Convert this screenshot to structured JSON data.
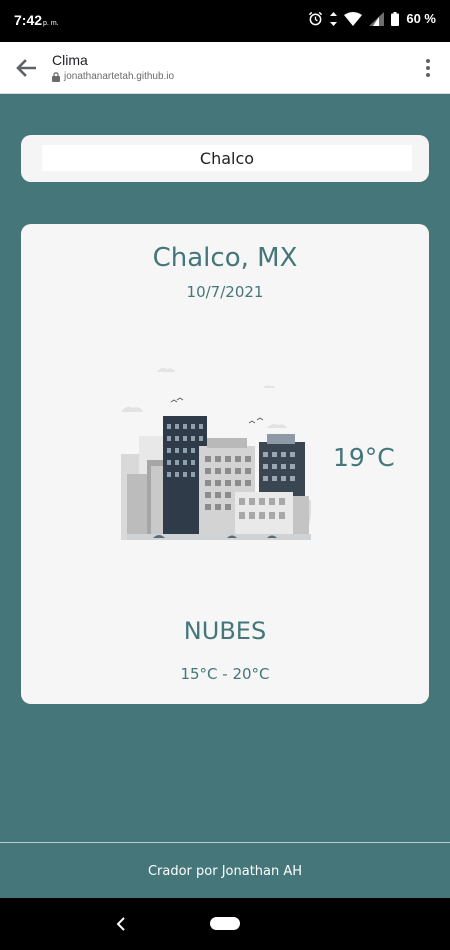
{
  "status_bar": {
    "time": "7:42",
    "time_suffix": "p. m.",
    "battery": "60 %",
    "icons": [
      "alarm-icon",
      "data-arrows-icon",
      "wifi-icon",
      "cell-signal-icon",
      "battery-icon"
    ]
  },
  "browser": {
    "title": "Clima",
    "url": "jonathanartetah.github.io",
    "icons": [
      "back-arrow-icon",
      "lock-icon",
      "more-vert-icon"
    ]
  },
  "search": {
    "value": "Chalco"
  },
  "weather": {
    "city": "Chalco, MX",
    "date": "10/7/2021",
    "temperature": "19°C",
    "condition": "NUBES",
    "range": "15°C - 20°C",
    "illustration": "city-buildings-clouds-illustration"
  },
  "footer": {
    "text": "Crador por Jonathan AH"
  },
  "colors": {
    "page_background": "#44767a",
    "card_background": "#f6f6f6",
    "text_accent": "#44767a",
    "status_bar": "#000000"
  }
}
